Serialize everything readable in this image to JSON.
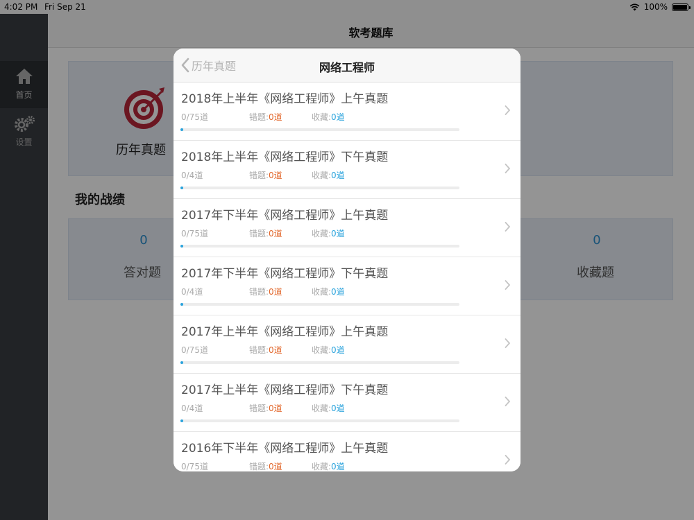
{
  "status_bar": {
    "time": "4:02 PM",
    "date": "Fri Sep 21",
    "battery": "100%"
  },
  "sidebar": {
    "items": [
      {
        "label": "首页",
        "icon": "home-icon"
      },
      {
        "label": "设置",
        "icon": "gear-icon"
      }
    ]
  },
  "navbar": {
    "title": "软考题库"
  },
  "home": {
    "card_title": "历年真题",
    "section_title": "我的战绩",
    "stats": [
      {
        "value": "0",
        "label": "答对题"
      },
      {
        "value": "0",
        "label": "收藏题"
      }
    ]
  },
  "modal": {
    "back_label": "历年真题",
    "title": "网络工程师",
    "rows": [
      {
        "title": "2018年上半年《网络工程师》上午真题",
        "progress": "0/75道",
        "wrong_label": "错题:",
        "wrong_value": "0道",
        "fav_label": "收藏:",
        "fav_value": "0道",
        "fill_fraction": 0.0
      },
      {
        "title": "2018年上半年《网络工程师》下午真题",
        "progress": "0/4道",
        "wrong_label": "错题:",
        "wrong_value": "0道",
        "fav_label": "收藏:",
        "fav_value": "0道",
        "fill_fraction": 0.0
      },
      {
        "title": "2017年下半年《网络工程师》上午真题",
        "progress": "0/75道",
        "wrong_label": "错题:",
        "wrong_value": "0道",
        "fav_label": "收藏:",
        "fav_value": "0道",
        "fill_fraction": 0.0
      },
      {
        "title": "2017年下半年《网络工程师》下午真题",
        "progress": "0/4道",
        "wrong_label": "错题:",
        "wrong_value": "0道",
        "fav_label": "收藏:",
        "fav_value": "0道",
        "fill_fraction": 0.0
      },
      {
        "title": "2017年上半年《网络工程师》上午真题",
        "progress": "0/75道",
        "wrong_label": "错题:",
        "wrong_value": "0道",
        "fav_label": "收藏:",
        "fav_value": "0道",
        "fill_fraction": 0.0
      },
      {
        "title": "2017年上半年《网络工程师》下午真题",
        "progress": "0/4道",
        "wrong_label": "错题:",
        "wrong_value": "0道",
        "fav_label": "收藏:",
        "fav_value": "0道",
        "fill_fraction": 0.0
      },
      {
        "title": "2016年下半年《网络工程师》上午真题",
        "progress": "0/75道",
        "wrong_label": "错题:",
        "wrong_value": "0道",
        "fav_label": "收藏:",
        "fav_value": "0道",
        "fill_fraction": 0.0
      }
    ]
  },
  "colors": {
    "accent_blue": "#2aa3dc",
    "wrong_orange": "#e2672b",
    "target_red": "#b8263a"
  }
}
